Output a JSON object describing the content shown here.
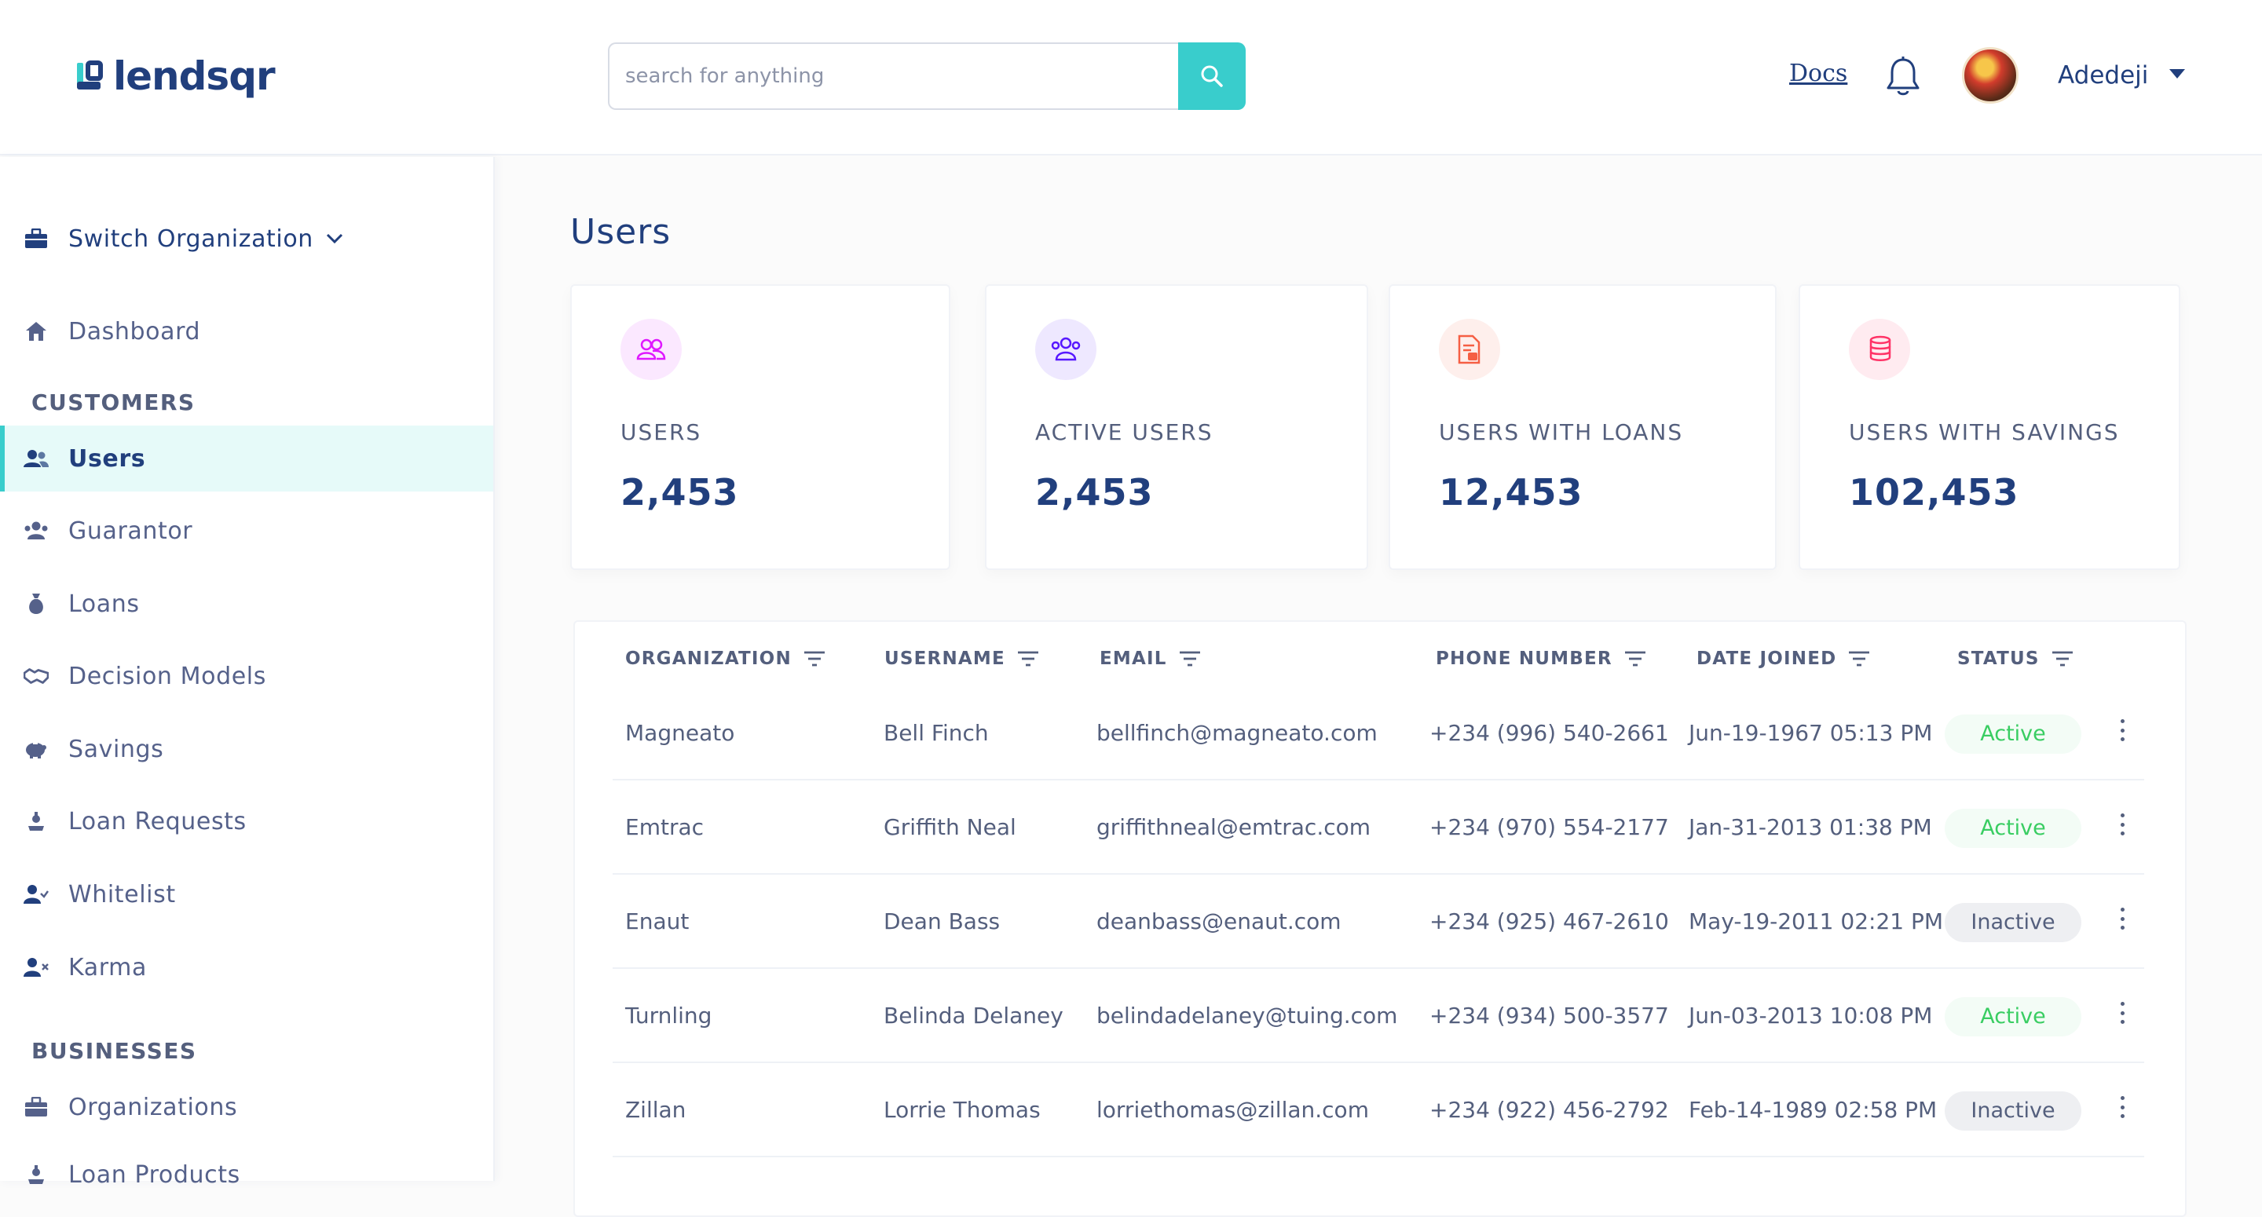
{
  "header": {
    "logo_text": "lendsqr",
    "search_placeholder": "search for anything",
    "docs_label": "Docs",
    "user_name": "Adedeji"
  },
  "sidebar": {
    "switch_org_label": "Switch Organization",
    "dashboard_label": "Dashboard",
    "customers_heading": "CUSTOMERS",
    "customer_items": [
      {
        "label": "Users",
        "icon": "users-icon",
        "active": true
      },
      {
        "label": "Guarantor",
        "icon": "guarantor-icon"
      },
      {
        "label": "Loans",
        "icon": "loans-icon"
      },
      {
        "label": "Decision Models",
        "icon": "handshake-icon"
      },
      {
        "label": "Savings",
        "icon": "piggy-bank-icon"
      },
      {
        "label": "Loan Requests",
        "icon": "loan-request-icon"
      },
      {
        "label": "Whitelist",
        "icon": "user-check-icon"
      },
      {
        "label": "Karma",
        "icon": "user-x-icon"
      }
    ],
    "businesses_heading": "BUSINESSES",
    "business_items": [
      {
        "label": "Organizations",
        "icon": "briefcase-icon"
      },
      {
        "label": "Loan Products",
        "icon": "loan-request-icon"
      }
    ]
  },
  "main": {
    "title": "Users",
    "cards": [
      {
        "label": "USERS",
        "value": "2,453",
        "icon": "users-icon",
        "color": "#df18ff"
      },
      {
        "label": "ACTIVE USERS",
        "value": "2,453",
        "icon": "active-users-icon",
        "color": "#5718ff"
      },
      {
        "label": "USERS WITH LOANS",
        "value": "12,453",
        "icon": "loans-doc-icon",
        "color": "#f55f44"
      },
      {
        "label": "USERS WITH SAVINGS",
        "value": "102,453",
        "icon": "coins-icon",
        "color": "#ff3366"
      }
    ],
    "table": {
      "headers": [
        "ORGANIZATION",
        "USERNAME",
        "EMAIL",
        "PHONE NUMBER",
        "DATE JOINED",
        "STATUS"
      ],
      "rows": [
        {
          "organization": "Magneato",
          "username": "Bell Finch",
          "email": "bellfinch@magneato.com",
          "phone": "+234 (996) 540-2661",
          "date": "Jun-19-1967 05:13 PM",
          "status": "Active"
        },
        {
          "organization": "Emtrac",
          "username": "Griffith Neal",
          "email": "griffithneal@emtrac.com",
          "phone": "+234 (970) 554-2177",
          "date": "Jan-31-2013 01:38 PM",
          "status": "Active"
        },
        {
          "organization": "Enaut",
          "username": "Dean Bass",
          "email": "deanbass@enaut.com",
          "phone": "+234 (925) 467-2610",
          "date": "May-19-2011 02:21 PM",
          "status": "Inactive"
        },
        {
          "organization": "Turnling",
          "username": "Belinda Delaney",
          "email": "belindadelaney@tuing.com",
          "phone": "+234 (934) 500-3577",
          "date": "Jun-03-2013 10:08 PM",
          "status": "Active"
        },
        {
          "organization": "Zillan",
          "username": "Lorrie Thomas",
          "email": "lorriethomas@zillan.com",
          "phone": "+234 (922) 456-2792",
          "date": "Feb-14-1989 02:58 PM",
          "status": "Inactive"
        }
      ]
    }
  },
  "colors": {
    "brand": "#213f7d",
    "accent": "#39cdcc",
    "active_status": "#39cd62",
    "text_muted": "#545f7d"
  }
}
